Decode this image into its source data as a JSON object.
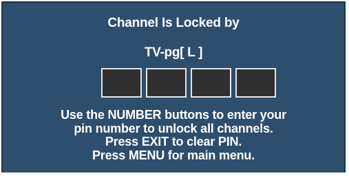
{
  "lock_screen": {
    "title": "Channel Is Locked by",
    "rating": "TV-pg[ L ]",
    "pin_slots": 4,
    "instructions": [
      "Use the NUMBER buttons to enter your",
      "pin number to unlock all channels.",
      "Press EXIT to clear PIN.",
      "Press MENU for main menu."
    ]
  },
  "colors": {
    "background": "#2d4e6c",
    "pin_box_fill": "#303030",
    "pin_box_border": "#e6e6e6",
    "text": "#ffffff"
  }
}
